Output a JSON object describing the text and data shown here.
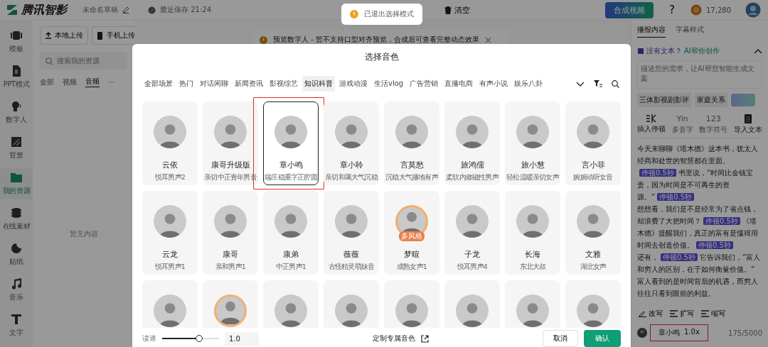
{
  "app": {
    "logo": "腾讯智影",
    "draft_title": "未命名草稿",
    "save_status": "最近保存 21:24",
    "clear_button": "清空",
    "compose_button": "合成视频",
    "help": "?",
    "coins": "17,280"
  },
  "toast": {
    "message": "已退出选择模式"
  },
  "rail": [
    {
      "label": "模板",
      "selected": false
    },
    {
      "label": "PPT模式",
      "selected": false
    },
    {
      "label": "数字人",
      "selected": false
    },
    {
      "label": "背景",
      "selected": false
    },
    {
      "label": "我的资源",
      "selected": true
    },
    {
      "label": "在线素材",
      "selected": false
    },
    {
      "label": "贴纸",
      "selected": false
    },
    {
      "label": "音乐",
      "selected": false
    },
    {
      "label": "文字",
      "selected": false
    }
  ],
  "resources": {
    "upload_local": "本地上传",
    "upload_phone": "手机上传",
    "search_placeholder": "搜索我的资源",
    "tabs": [
      {
        "label": "全部",
        "selected": false
      },
      {
        "label": "视频",
        "selected": false
      },
      {
        "label": "音频",
        "selected": true
      }
    ],
    "more": "···",
    "empty": "暂无内容"
  },
  "notice": {
    "text": "预览数字人 - 暂不支持口型对齐预览，合成后可查看完整动态效果"
  },
  "right_panel": {
    "tabs": [
      {
        "label": "播报内容",
        "selected": true
      },
      {
        "label": "字幕样式",
        "selected": false
      }
    ],
    "ai_prompt": {
      "question": "没有文本？",
      "link": "AI帮你创作",
      "expanded": true
    },
    "prompt_placeholder": "描述您的需求，让AI帮您智能生成文案",
    "chips": [
      "三体影视剧影评",
      "家庭关系"
    ],
    "tools": [
      {
        "label": "插入停顿",
        "disabled": false
      },
      {
        "label": "多音字",
        "icon_text": "Yin",
        "disabled": true
      },
      {
        "label": "数字符号",
        "icon_text": "123",
        "disabled": true
      },
      {
        "label": "导入文本",
        "disabled": false
      }
    ],
    "script": [
      [
        {
          "kind": "text",
          "text": "今天来聊聊《塔木德》这本书，犹太人经商和处世的智慧都在里面。"
        },
        {
          "kind": "pause",
          "text": "停顿0.5秒"
        },
        {
          "kind": "text",
          "text": "书里说，“时间比金钱宝贵，因为时间是不可再生的资源。”"
        },
        {
          "kind": "pause",
          "text": "停顿0.5秒"
        }
      ],
      [
        {
          "kind": "text",
          "text": "想想看，我们是不是经常为了省点钱，却浪费了大把时间？"
        },
        {
          "kind": "pause",
          "text": "停顿0.5秒"
        },
        {
          "kind": "text",
          "text": "《塔木德》提醒我们，真正的富有是懂得用时间去创造价值。"
        },
        {
          "kind": "pause",
          "text": "停顿0.5秒"
        }
      ],
      [
        {
          "kind": "text",
          "text": "还有，"
        },
        {
          "kind": "pause",
          "text": "停顿0.5秒"
        },
        {
          "kind": "text",
          "text": "它告诉我们，“富人和穷人的区别，在于如何衡量价值。”"
        }
      ],
      [
        {
          "kind": "text",
          "text": "富人看到的是时间背后的机遇，而穷人往往只看到眼前的利益。"
        }
      ]
    ],
    "rewrite_tools": [
      "改写",
      "扩写",
      "缩写"
    ],
    "voice": {
      "name": "章小鸣",
      "speed": "1.0x",
      "annotated": true
    },
    "char_count": "175/5000"
  },
  "dialog": {
    "title": "选择音色",
    "tabs": [
      {
        "label": "全部场景",
        "selected": false
      },
      {
        "label": "热门",
        "selected": false
      },
      {
        "label": "对话闲聊",
        "selected": false
      },
      {
        "label": "新闻资讯",
        "selected": false
      },
      {
        "label": "影视综艺",
        "selected": false
      },
      {
        "label": "知识科普",
        "selected": true
      },
      {
        "label": "游戏动漫",
        "selected": false
      },
      {
        "label": "生活vlog",
        "selected": false
      },
      {
        "label": "广告营销",
        "selected": false
      },
      {
        "label": "直播电商",
        "selected": false
      },
      {
        "label": "有声小说",
        "selected": false
      },
      {
        "label": "娱乐八卦",
        "selected": false
      }
    ],
    "voices": [
      {
        "name": "云依",
        "description": "悦耳男声2",
        "selected": false,
        "annotated": false,
        "ring": false
      },
      {
        "name": "康哥升级版",
        "description": "亲切中正青年男音",
        "selected": false,
        "annotated": false,
        "ring": false
      },
      {
        "name": "章小鸣",
        "description": "端庄稳重字正腔圆",
        "selected": true,
        "annotated": true,
        "ring": false
      },
      {
        "name": "章小聆",
        "description": "亲切和蔼大气沉稳",
        "selected": false,
        "annotated": false,
        "ring": false
      },
      {
        "name": "言莫愁",
        "description": "沉稳大气播地有声",
        "selected": false,
        "annotated": false,
        "ring": false
      },
      {
        "name": "旅鸿儒",
        "description": "柔软内敛磁性男声",
        "selected": false,
        "annotated": false,
        "ring": false
      },
      {
        "name": "旅小慧",
        "description": "轻松温暖亲切女声",
        "selected": false,
        "annotated": false,
        "ring": false
      },
      {
        "name": "言小菲",
        "description": "婉婉动听女音",
        "selected": false,
        "annotated": false,
        "ring": false
      },
      {
        "name": "云龙",
        "description": "悦耳男声1",
        "selected": false,
        "annotated": false,
        "ring": false
      },
      {
        "name": "康哥",
        "description": "亲和男声1",
        "selected": false,
        "annotated": false,
        "ring": false
      },
      {
        "name": "康弟",
        "description": "中正男声1",
        "selected": false,
        "annotated": false,
        "ring": false
      },
      {
        "name": "薇薇",
        "description": "古怪精灵萌妹音",
        "selected": false,
        "annotated": false,
        "ring": false
      },
      {
        "name": "梦暄",
        "description": "成熟女声1",
        "selected": false,
        "annotated": false,
        "ring": true,
        "badge": "多风格"
      },
      {
        "name": "子龙",
        "description": "悦耳男声4",
        "selected": false,
        "annotated": false,
        "ring": false
      },
      {
        "name": "长海",
        "description": "东北大叔",
        "selected": false,
        "annotated": false,
        "ring": false
      },
      {
        "name": "文雅",
        "description": "湖北女声",
        "selected": false,
        "annotated": false,
        "ring": false
      },
      {
        "selected": false,
        "annotated": false,
        "ring": false
      },
      {
        "selected": false,
        "annotated": false,
        "ring": true
      },
      {
        "selected": false,
        "annotated": false,
        "ring": false
      },
      {
        "selected": false,
        "annotated": false,
        "ring": false
      },
      {
        "selected": false,
        "annotated": false,
        "ring": false
      },
      {
        "selected": false,
        "annotated": false,
        "ring": false
      },
      {
        "selected": false,
        "annotated": false,
        "ring": false
      },
      {
        "selected": false,
        "annotated": false,
        "ring": false
      }
    ],
    "footer": {
      "speed_label": "读速",
      "speed": {
        "level": 0.65
      },
      "speed_value": "1.0",
      "custom_link": "定制专属音色",
      "cancel": "取消",
      "confirm": "确认"
    }
  }
}
